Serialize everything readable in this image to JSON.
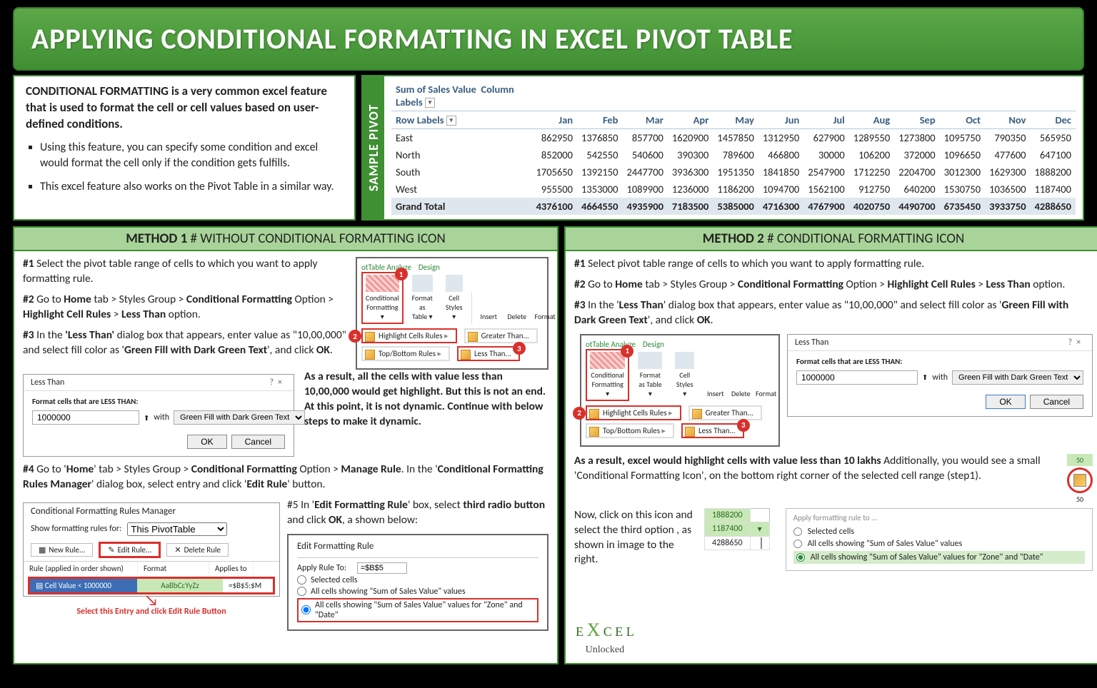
{
  "title": "APPLYING CONDITIONAL FORMATTING IN EXCEL PIVOT TABLE",
  "intro": {
    "lead": "CONDITIONAL FORMATTING is a very common excel feature that is used to format the cell or cell values based on user-defined conditions.",
    "b1": "Using this feature, you can specify some condition and excel would format the cell only if the condition gets fulfills.",
    "b2": "This excel feature also works on the Pivot Table in a similar way."
  },
  "sample": {
    "label": "SAMPLE PIVOT",
    "corner": "Sum of Sales Value",
    "collabel": "Column Labels",
    "rowlabel": "Row Labels",
    "months": [
      "Jan",
      "Feb",
      "Mar",
      "Apr",
      "May",
      "Jun",
      "Jul",
      "Aug",
      "Sep",
      "Oct",
      "Nov",
      "Dec"
    ],
    "rows": [
      {
        "name": "East",
        "v": [
          862950,
          1376850,
          857700,
          1620900,
          1457850,
          1312950,
          627900,
          1289550,
          1273800,
          1095750,
          790350,
          565950
        ]
      },
      {
        "name": "North",
        "v": [
          852000,
          542550,
          540600,
          390300,
          789600,
          466800,
          30000,
          106200,
          372000,
          1096650,
          477600,
          647100
        ]
      },
      {
        "name": "South",
        "v": [
          1705650,
          1392150,
          2447700,
          3936300,
          1951350,
          1841850,
          2547900,
          1712250,
          2204700,
          3012300,
          1629300,
          1888200
        ]
      },
      {
        "name": "West",
        "v": [
          955500,
          1353000,
          1089900,
          1236000,
          1186200,
          1094700,
          1562100,
          912750,
          640200,
          1530750,
          1036500,
          1187400
        ]
      }
    ],
    "grand": {
      "name": "Grand Total",
      "v": [
        4376100,
        4664550,
        4935900,
        7183500,
        5385000,
        4716300,
        4767900,
        4020750,
        4490700,
        6735450,
        3933750,
        4288650
      ]
    }
  },
  "method1": {
    "header_b": "METHOD 1",
    "header_r": " # WITHOUT CONDITIONAL FORMATTING ICON",
    "s1a": "#1 ",
    "s1b": "Select the pivot table range of cells to which you want to apply formatting rule.",
    "s2": "#2 Go to Home tab > Styles Group > Conditional Formatting Option > Highlight Cell Rules > Less Than option.",
    "s3": "#3 In the 'Less Than' dialog box that appears, enter value as \"10,00,000\" and select fill color as  'Green Fill with Dark Green Text', and click OK.",
    "result": "As a result, all the cells with value less than 10,00,000 would get highlight. But this is not an end. At this point, it is not dynamic. Continue with below steps to make it dynamic.",
    "s4": "#4 Go to 'Home' tab > Styles Group > Conditional Formatting Option > Manage Rule. In the 'Conditional Formatting Rules Manager' dialog box, select entry and click 'Edit Rule' button.",
    "s5": "#5 In 'Edit Formatting Rule' box, select third radio button and click OK, a shown below:",
    "red": "Select this Entry and click Edit Rule Button"
  },
  "ribbon": {
    "tab1": "otTable Analyze",
    "tab2": "Design",
    "cf": "Conditional Formatting",
    "fat": "Format as Table",
    "cs": "Cell Styles",
    "ins": "Insert",
    "del": "Delete",
    "fmt": "Format",
    "hcr": "Highlight Cells Rules",
    "tbr": "Top/Bottom Rules",
    "gt": "Greater Than...",
    "lt": "Less Than..."
  },
  "lessthan": {
    "title": "Less Than",
    "q": "?",
    "x": "×",
    "lbl": "Format cells that are LESS THAN:",
    "val": "1000000",
    "with": "with",
    "fill": "Green Fill with Dark Green Text",
    "ok": "OK",
    "cancel": "Cancel"
  },
  "mgr": {
    "title": "Conditional Formatting Rules Manager",
    "show": "Show formatting rules for:",
    "scope": "This PivotTable",
    "new": "New Rule...",
    "edit": "Edit Rule...",
    "del": "Delete Rule",
    "c1": "Rule (applied in order shown)",
    "c2": "Format",
    "c3": "Applies to",
    "rule": "Cell Value < 1000000",
    "fmt": "AaBbCcYyZz",
    "app": "=$B$5:$M"
  },
  "efr": {
    "title": "Edit Formatting Rule",
    "apply": "Apply Rule To:",
    "ref": "=$B$5",
    "r1": "Selected cells",
    "r2": "All cells showing \"Sum of Sales Value\" values",
    "r3": "All cells showing \"Sum of Sales Value\" values for \"Zone\" and \"Date\""
  },
  "method2": {
    "header_b": "METHOD 2",
    "header_r": " # CONDITIONAL FORMATTING ICON",
    "s1": "#1 Select pivot table range of cells to which you want to apply formatting rule.",
    "s2": "#2 Go to Home tab > Styles Group > Conditional Formatting Option > Highlight Cell Rules > Less Than option.",
    "s3": "#3 In the 'Less Than' dialog box that appears, enter value as \"10,00,000\" and select fill color as  'Green Fill with Dark Green Text', and click OK.",
    "res1": "As a result, excel would highlight cells with value less than 10 lakhs",
    "res2": "Additionally, you would see a small 'Conditional Formatting Icon', on the bottom right corner of the selected cell range (step1).",
    "s4": "Now, click on this icon and select the third option , as shown in image to the right.",
    "fopt_t": "Apply formatting rule to ...",
    "fopt_1": "Selected cells",
    "fopt_2": "All cells showing \"Sum of Sales Value\" values",
    "fopt_3": "All cells showing \"Sum of Sales Value\" values for \"Zone\" and \"Date\"",
    "cells": [
      [
        "1888200"
      ],
      [
        "1187400"
      ],
      [
        "4288650"
      ]
    ]
  },
  "logo": {
    "a": "E",
    "b": "X",
    "c": "C E L",
    "d": "Unlocked"
  }
}
